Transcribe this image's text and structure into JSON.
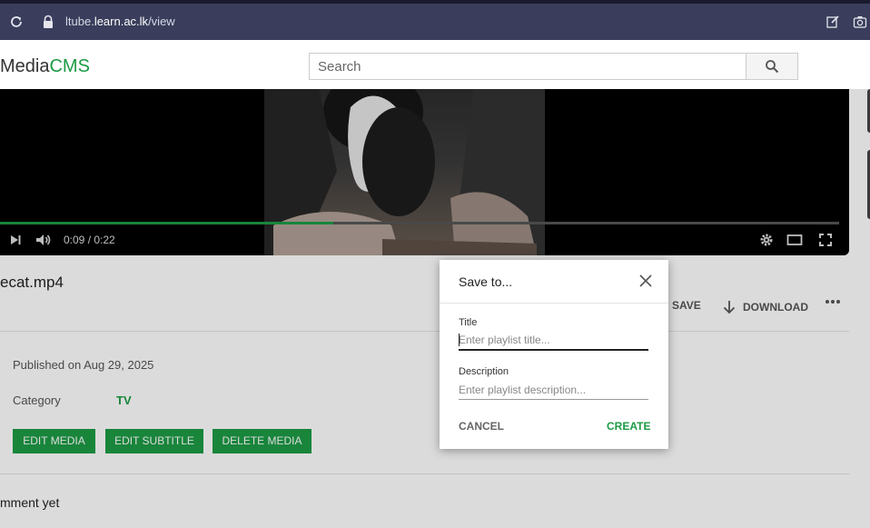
{
  "browser": {
    "url_prefix": "ltube.",
    "url_domain": "learn.ac.lk",
    "url_path": "/view",
    "icons": [
      "reload-icon",
      "lock-icon",
      "edit-note-icon",
      "camera-icon"
    ]
  },
  "header": {
    "logo_media": "Media",
    "logo_cms": "CMS",
    "search_placeholder": "Search",
    "accent_color": "#1c9b45"
  },
  "player": {
    "time": "0:09 / 0:22",
    "progress": 0.397,
    "icons": [
      "next-icon",
      "volume-icon",
      "settings-icon",
      "theater-mode-icon",
      "fullscreen-icon"
    ]
  },
  "media": {
    "title": "ecat.mp4",
    "save_label": "SAVE",
    "download_label": "DOWNLOAD",
    "published": "Published on Aug 29, 2025",
    "category_label": "Category",
    "category_value": "TV",
    "buttons": {
      "edit_media": "EDIT MEDIA",
      "edit_subtitle": "EDIT SUBTITLE",
      "delete_media": "DELETE MEDIA"
    },
    "comments_text": "mment yet"
  },
  "dialog": {
    "title": "Save to...",
    "title_label": "Title",
    "title_placeholder": "Enter playlist title...",
    "description_label": "Description",
    "description_placeholder": "Enter playlist description...",
    "cancel_label": "CANCEL",
    "create_label": "CREATE"
  }
}
